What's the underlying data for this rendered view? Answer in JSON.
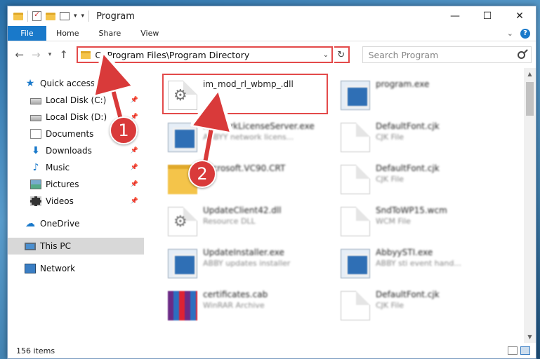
{
  "window": {
    "title": "Program",
    "controls": {
      "minimize": "—",
      "maximize": "☐",
      "close": "✕"
    }
  },
  "ribbon": {
    "file": "File",
    "tabs": [
      "Home",
      "Share",
      "View"
    ],
    "help": "?"
  },
  "address": {
    "path": "C:\\Program Files\\Program Directory"
  },
  "search": {
    "placeholder": "Search Program"
  },
  "sidebar": {
    "quick_access": "Quick access",
    "items": [
      {
        "label": "Local Disk (C:)"
      },
      {
        "label": "Local Disk (D:)"
      },
      {
        "label": "Documents"
      },
      {
        "label": "Downloads"
      },
      {
        "label": "Music"
      },
      {
        "label": "Pictures"
      },
      {
        "label": "Videos"
      }
    ],
    "onedrive": "OneDrive",
    "this_pc": "This PC",
    "network": "Network"
  },
  "files": [
    {
      "name": "im_mod_rl_wbmp_.dll",
      "type": ""
    },
    {
      "name": "program.exe",
      "type": ""
    },
    {
      "name": "NetworkLicenseServer.exe",
      "type": "ABBYY network licens..."
    },
    {
      "name": "DefaultFont.cjk",
      "type": "CJK File"
    },
    {
      "name": "Microsoft.VC90.CRT",
      "type": ""
    },
    {
      "name": "DefaultFont.cjk",
      "type": "CJK File"
    },
    {
      "name": "UpdateClient42.dll",
      "type": "Resource DLL"
    },
    {
      "name": "SndToWP15.wcm",
      "type": "WCM File"
    },
    {
      "name": "UpdateInstaller.exe",
      "type": "ABBY updates installer"
    },
    {
      "name": "AbbyySTI.exe",
      "type": "ABBY sti event hand..."
    },
    {
      "name": "certificates.cab",
      "type": "WinRAR Archive"
    },
    {
      "name": "DefaultFont.cjk",
      "type": "CJK File"
    }
  ],
  "status": {
    "items": "156 items"
  },
  "annotations": {
    "step1": "1",
    "step2": "2"
  }
}
